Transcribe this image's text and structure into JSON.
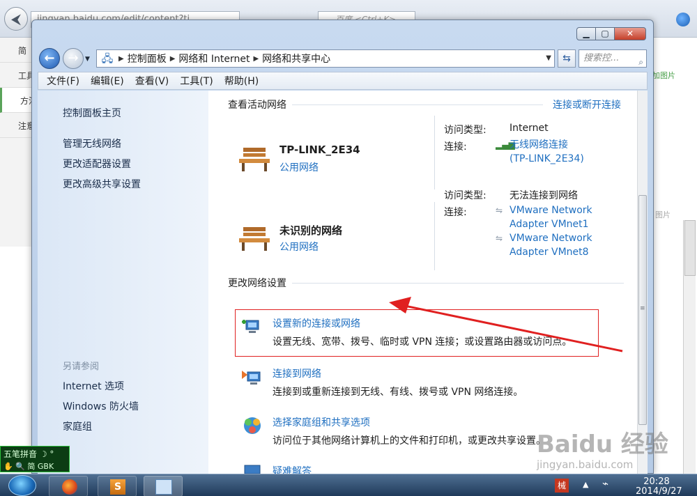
{
  "background_browser": {
    "url_text": "jingyan.baidu.com/edit/content?ti",
    "search_placeholder": "百度 <Ctrl+K>",
    "left_items": [
      "简",
      "工具",
      "方法",
      "注意"
    ],
    "right_add_label": "加图片",
    "right_img_label": "图片"
  },
  "window": {
    "controls": {
      "minimize": "▁",
      "maximize": "▢",
      "close": "✕"
    },
    "address": {
      "crumbs": [
        "控制面板",
        "网络和 Internet",
        "网络和共享中心"
      ],
      "search_placeholder": "搜索控..."
    },
    "menu": [
      "文件(F)",
      "编辑(E)",
      "查看(V)",
      "工具(T)",
      "帮助(H)"
    ],
    "sidebar": {
      "home": "控制面板主页",
      "links": [
        "管理无线网络",
        "更改适配器设置",
        "更改高级共享设置"
      ],
      "see_also_title": "另请参阅",
      "see_also": [
        "Internet 选项",
        "Windows 防火墙",
        "家庭组"
      ]
    },
    "active_networks": {
      "title": "查看活动网络",
      "connect_link": "连接或断开连接",
      "networks": [
        {
          "name": "TP-LINK_2E34",
          "type": "公用网络",
          "access_label": "访问类型:",
          "access_value": "Internet",
          "conn_label": "连接:",
          "connections": [
            "无线网络连接",
            "(TP-LINK_2E34)"
          ]
        },
        {
          "name": "未识别的网络",
          "type": "公用网络",
          "access_label": "访问类型:",
          "access_value": "无法连接到网络",
          "conn_label": "连接:",
          "connections": [
            "VMware Network",
            "Adapter VMnet1",
            "VMware Network",
            "Adapter VMnet8"
          ]
        }
      ]
    },
    "change_settings": {
      "title": "更改网络设置",
      "tasks": [
        {
          "title": "设置新的连接或网络",
          "desc": "设置无线、宽带、拨号、临时或 VPN 连接；或设置路由器或访问点。"
        },
        {
          "title": "连接到网络",
          "desc": "连接到或重新连接到无线、有线、拨号或 VPN 网络连接。"
        },
        {
          "title": "选择家庭组和共享选项",
          "desc": "访问位于其他网络计算机上的文件和打印机，或更改共享设置。"
        },
        {
          "title": "疑难解答",
          "desc": ""
        }
      ]
    }
  },
  "ime": {
    "top": "五笔拼音 ☽ °",
    "bottom": "✋ 🔍 简 GBK"
  },
  "taskbar": {
    "clock_time": "20:28",
    "clock_date": "2014/9/27",
    "tray_ime": "械"
  },
  "watermark": {
    "main": "Baidu 经验",
    "sub": "jingyan.baidu.com"
  },
  "colors": {
    "link": "#1f6fc0",
    "highlight": "#e02020",
    "sidebar_bg": "#dbe7f6"
  }
}
